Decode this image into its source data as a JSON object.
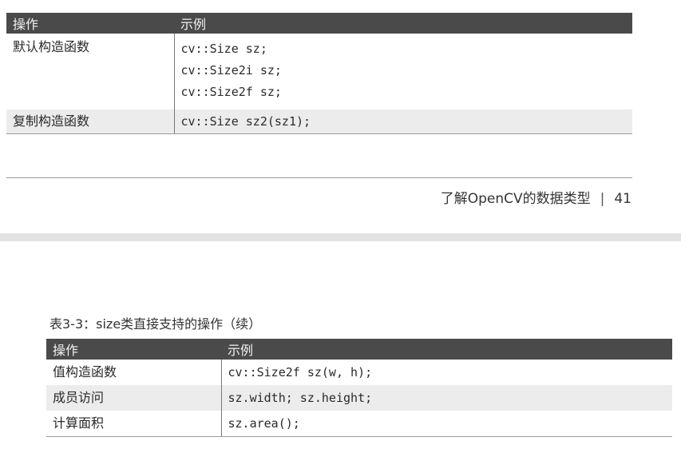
{
  "table1": {
    "headers": [
      "操作",
      "示例"
    ],
    "rows": [
      {
        "op": "默认构造函数",
        "examples": [
          "cv::Size sz;",
          "cv::Size2i sz;",
          "cv::Size2f sz;"
        ]
      },
      {
        "op": "复制构造函数",
        "examples": [
          "cv::Size sz2(sz1);"
        ]
      }
    ]
  },
  "footer": {
    "chapter_title": "了解OpenCV的数据类型",
    "separator": "|",
    "page_number": "41"
  },
  "table2": {
    "caption": "表3-3：size类直接支持的操作（续）",
    "headers": [
      "操作",
      "示例"
    ],
    "rows": [
      {
        "op": "值构造函数",
        "example": "cv::Size2f sz(w, h);"
      },
      {
        "op": "成员访问",
        "example": "sz.width; sz.height;"
      },
      {
        "op": "计算面积",
        "example": "sz.area();"
      }
    ]
  }
}
